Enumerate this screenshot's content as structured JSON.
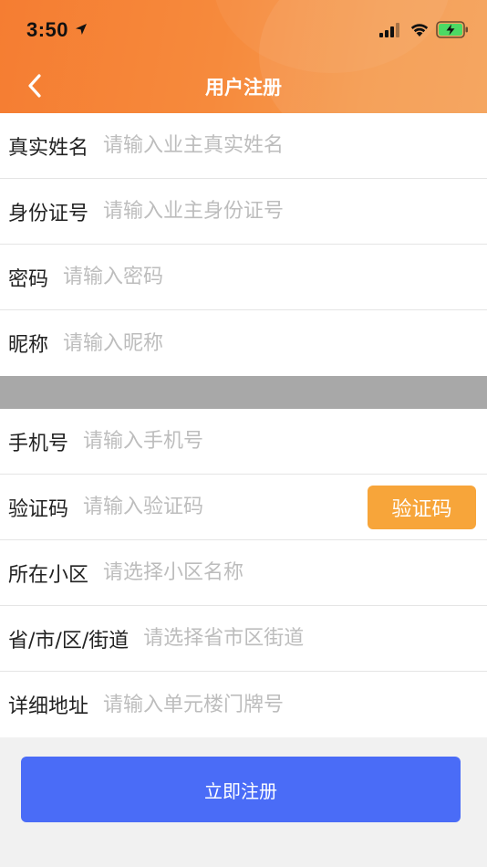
{
  "status_bar": {
    "time": "3:50",
    "icons": [
      "location-arrow-icon",
      "cellular-signal-icon",
      "wifi-icon",
      "battery-charging-icon"
    ]
  },
  "nav": {
    "title": "用户注册",
    "back_icon": "chevron-left-icon"
  },
  "colors": {
    "header_orange": "#f68a3c",
    "code_button": "#f7a53a",
    "submit_button": "#4a6cf7",
    "divider_band": "#a8a8a8"
  },
  "section1": {
    "rows": [
      {
        "label": "真实姓名",
        "placeholder": "请输入业主真实姓名"
      },
      {
        "label": "身份证号",
        "placeholder": "请输入业主身份证号"
      },
      {
        "label": "密码",
        "placeholder": "请输入密码"
      },
      {
        "label": "昵称",
        "placeholder": "请输入昵称"
      }
    ]
  },
  "section2": {
    "rows": [
      {
        "label": "手机号",
        "placeholder": "请输入手机号"
      },
      {
        "label": "验证码",
        "placeholder": "请输入验证码",
        "button": "验证码"
      },
      {
        "label": "所在小区",
        "placeholder": "请选择小区名称"
      },
      {
        "label": "省/市/区/街道",
        "placeholder": "请选择省市区街道"
      },
      {
        "label": "详细地址",
        "placeholder": "请输入单元楼门牌号"
      }
    ]
  },
  "submit": {
    "label": "立即注册"
  }
}
